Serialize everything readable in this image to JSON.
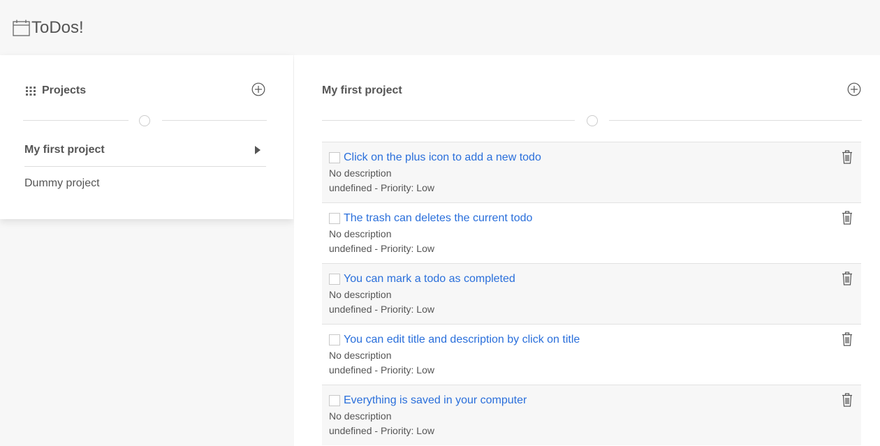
{
  "app": {
    "title": "ToDos!",
    "logo_icon": "calendar-icon"
  },
  "sidebar": {
    "heading": "Projects",
    "heading_icon": "grid-icon",
    "add_icon": "plus-circle-icon",
    "projects": [
      {
        "name": "My first project",
        "active": true
      },
      {
        "name": "Dummy project",
        "active": false
      }
    ]
  },
  "main": {
    "project_title": "My first project",
    "add_icon": "plus-circle-icon",
    "todos": [
      {
        "title": "Click on the plus icon to add a new todo",
        "description": "No description",
        "meta": "undefined - Priority: Low",
        "completed": false
      },
      {
        "title": "The trash can deletes the current todo",
        "description": "No description",
        "meta": "undefined - Priority: Low",
        "completed": false
      },
      {
        "title": "You can mark a todo as completed",
        "description": "No description",
        "meta": "undefined - Priority: Low",
        "completed": false
      },
      {
        "title": "You can edit title and description by click on title",
        "description": "No description",
        "meta": "undefined - Priority: Low",
        "completed": false
      },
      {
        "title": "Everything is saved in your computer",
        "description": "No description",
        "meta": "undefined - Priority: Low",
        "completed": false
      }
    ]
  },
  "colors": {
    "link": "#2a6fdb",
    "text": "#555555",
    "background": "#f7f7f7"
  }
}
